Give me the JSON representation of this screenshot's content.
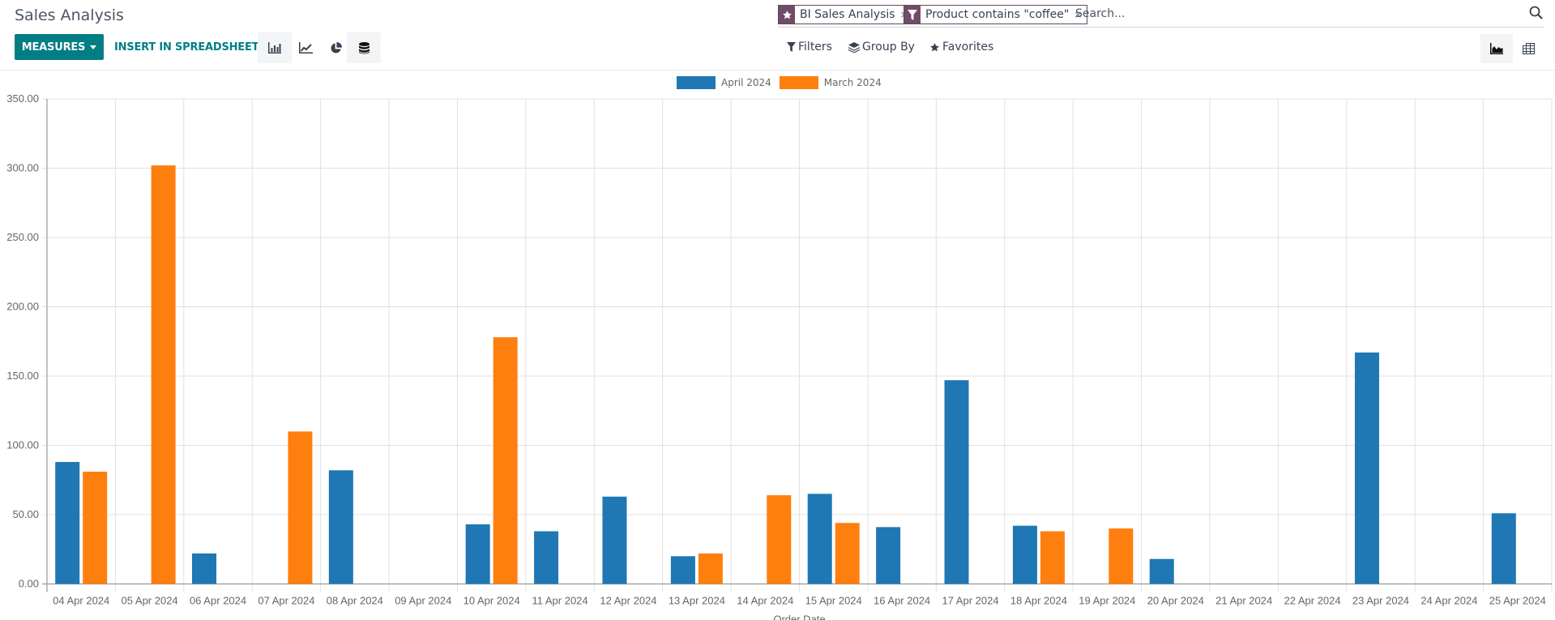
{
  "header": {
    "title": "Sales Analysis",
    "measures_label": "MEASURES",
    "insert_label": "INSERT IN SPREADSHEET",
    "chart_type_buttons": [
      {
        "name": "bar-chart",
        "active": true
      },
      {
        "name": "line-chart",
        "active": false
      },
      {
        "name": "pie-chart",
        "active": false
      },
      {
        "name": "stack",
        "active": true
      }
    ]
  },
  "search": {
    "facets": [
      {
        "icon": "star-icon",
        "label": "BI Sales Analysis"
      },
      {
        "icon": "filter-icon",
        "label": "Product contains \"coffee\""
      }
    ],
    "placeholder": "Search...",
    "value": ""
  },
  "panel": {
    "filters_label": "Filters",
    "groupby_label": "Group By",
    "favorites_label": "Favorites"
  },
  "view_switcher": [
    {
      "name": "graph-view",
      "active": true
    },
    {
      "name": "pivot-view",
      "active": false
    }
  ],
  "colors": {
    "primary": "#017e84",
    "facet": "#714b67",
    "series_april": "#1f77b4",
    "series_march": "#ff7f0e"
  },
  "chart_data": {
    "type": "bar",
    "title": "",
    "xlabel": "Order Date",
    "ylabel": "",
    "ylim": [
      0,
      350
    ],
    "yticks": [
      0,
      50,
      100,
      150,
      200,
      250,
      300,
      350
    ],
    "ytick_labels": [
      "0.00",
      "50.00",
      "100.00",
      "150.00",
      "200.00",
      "250.00",
      "300.00",
      "350.00"
    ],
    "grid": true,
    "legend_position": "top-center",
    "categories": [
      "04 Apr 2024",
      "05 Apr 2024",
      "06 Apr 2024",
      "07 Apr 2024",
      "08 Apr 2024",
      "09 Apr 2024",
      "10 Apr 2024",
      "11 Apr 2024",
      "12 Apr 2024",
      "13 Apr 2024",
      "14 Apr 2024",
      "15 Apr 2024",
      "16 Apr 2024",
      "17 Apr 2024",
      "18 Apr 2024",
      "19 Apr 2024",
      "20 Apr 2024",
      "21 Apr 2024",
      "22 Apr 2024",
      "23 Apr 2024",
      "24 Apr 2024",
      "25 Apr 2024"
    ],
    "series": [
      {
        "name": "April 2024",
        "color": "#1f77b4",
        "values": [
          88,
          0,
          22,
          0,
          82,
          0,
          43,
          38,
          63,
          20,
          0,
          65,
          41,
          147,
          42,
          0,
          18,
          0,
          0,
          167,
          0,
          51
        ]
      },
      {
        "name": "March 2024",
        "color": "#ff7f0e",
        "values": [
          81,
          302,
          0,
          110,
          0,
          0,
          178,
          0,
          0,
          22,
          64,
          44,
          0,
          0,
          38,
          40,
          0,
          0,
          0,
          0,
          0,
          0
        ]
      }
    ]
  }
}
